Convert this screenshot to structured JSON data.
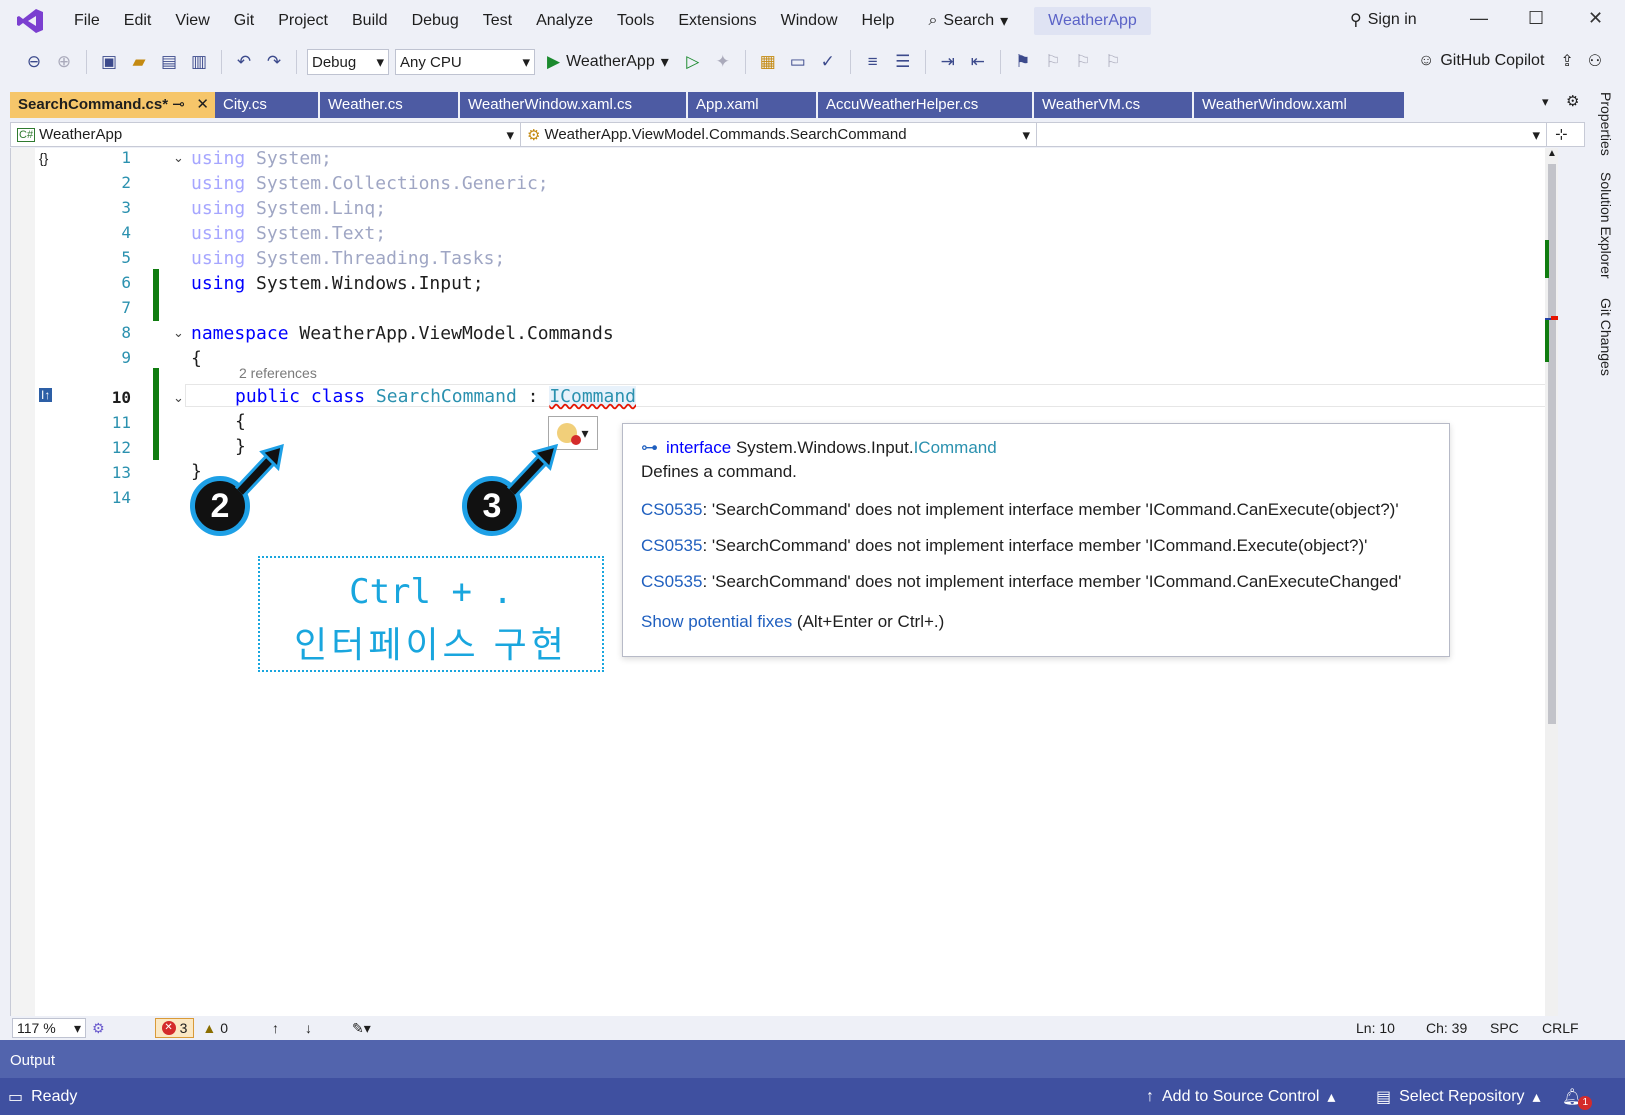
{
  "menubar": {
    "items": [
      "File",
      "Edit",
      "View",
      "Git",
      "Project",
      "Build",
      "Debug",
      "Test",
      "Analyze",
      "Tools",
      "Extensions",
      "Window",
      "Help"
    ],
    "search_label": "Search",
    "solution_name": "WeatherApp",
    "signin_label": "Sign in"
  },
  "toolbar": {
    "config": "Debug",
    "platform": "Any CPU",
    "run_target": "WeatherApp",
    "copilot_label": "GitHub Copilot"
  },
  "tabs": [
    {
      "label": "SearchCommand.cs*",
      "pin": "⊸",
      "close": "✕"
    },
    {
      "label": "City.cs"
    },
    {
      "label": "Weather.cs"
    },
    {
      "label": "WeatherWindow.xaml.cs"
    },
    {
      "label": "App.xaml"
    },
    {
      "label": "AccuWeatherHelper.cs"
    },
    {
      "label": "WeatherVM.cs"
    },
    {
      "label": "WeatherWindow.xaml"
    }
  ],
  "navbar": {
    "project": "WeatherApp",
    "type": "WeatherApp.ViewModel.Commands.SearchCommand",
    "member": ""
  },
  "side_panels": [
    "Properties",
    "Solution Explorer",
    "Git Changes"
  ],
  "editor": {
    "line_numbers": [
      "1",
      "2",
      "3",
      "4",
      "5",
      "6",
      "7",
      "8",
      "9",
      "10",
      "11",
      "12",
      "13",
      "14"
    ],
    "current_line": "10",
    "codelens": "2 references",
    "lines": {
      "l1": {
        "kw": "using",
        "rest": " System;"
      },
      "l2": {
        "kw": "using",
        "rest": " System.Collections.Generic;"
      },
      "l3": {
        "kw": "using",
        "rest": " System.Linq;"
      },
      "l4": {
        "kw": "using",
        "rest": " System.Text;"
      },
      "l5": {
        "kw": "using",
        "rest": " System.Threading.Tasks;"
      },
      "l6": {
        "kw": "using",
        "rest": " System.Windows.Input;"
      },
      "l8": {
        "kw": "namespace",
        "rest": " WeatherApp.ViewModel.Commands"
      },
      "l9": "{",
      "l10": {
        "kw1": "public",
        "kw2": "class",
        "name": "SearchCommand",
        "colon": " : ",
        "iface": "ICommand"
      },
      "l11": "{",
      "l12": "}",
      "l13": "}"
    }
  },
  "tooltip": {
    "kw": "interface",
    "ns": "System.Windows.Input.",
    "type": "ICommand",
    "desc": "Defines a command.",
    "diagnostics": [
      {
        "code": "CS0535",
        "msg": ": 'SearchCommand' does not implement interface member 'ICommand.CanExecute(object?)'"
      },
      {
        "code": "CS0535",
        "msg": ": 'SearchCommand' does not implement interface member 'ICommand.Execute(object?)'"
      },
      {
        "code": "CS0535",
        "msg": ": 'SearchCommand' does not implement interface member 'ICommand.CanExecuteChanged'"
      }
    ],
    "fix_link": "Show potential fixes",
    "fix_hint": " (Alt+Enter or Ctrl+.)"
  },
  "annotations": {
    "badge2": "2",
    "badge3": "3",
    "box_line1": "Ctrl + .",
    "box_line2": "인터페이스 구현"
  },
  "editor_status": {
    "zoom": "117 %",
    "errors": "3",
    "warnings": "0",
    "ln": "Ln: 10",
    "ch": "Ch: 39",
    "spc": "SPC",
    "crlf": "CRLF"
  },
  "output_label": "Output",
  "statusbar": {
    "ready": "Ready",
    "add_source": "Add to Source Control",
    "select_repo": "Select Repository",
    "notif_count": "1"
  },
  "colors": {
    "accent": "#5264ad",
    "active_tab": "#f6c66a",
    "keyword": "#0000ff",
    "type": "#2b91af",
    "annotation": "#19a6de"
  }
}
